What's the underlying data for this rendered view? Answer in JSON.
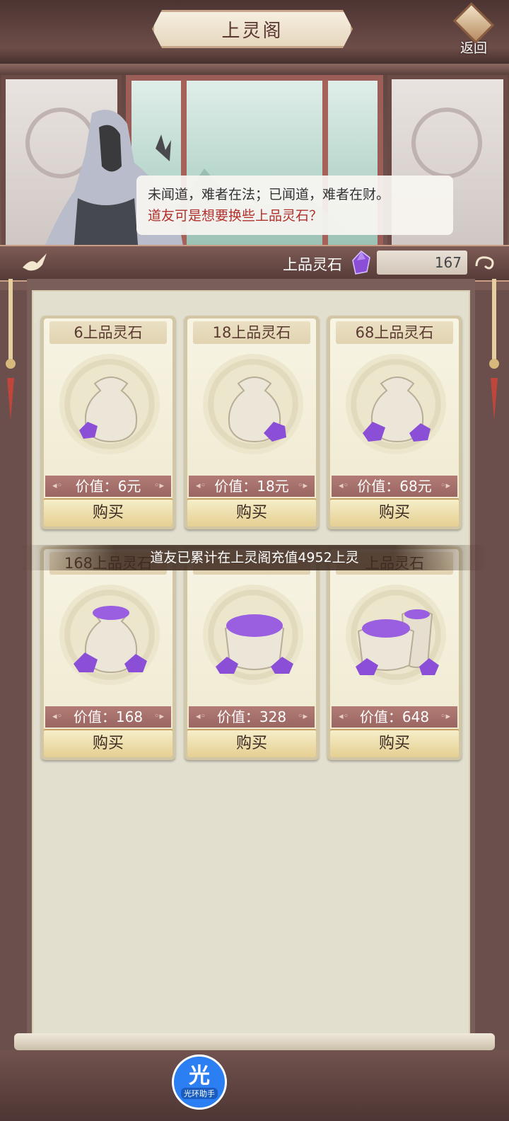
{
  "header": {
    "title": "上灵阁",
    "back_label": "返回"
  },
  "dialogue": {
    "line1": "未闻道，难者在法；已闻道，难者在财。",
    "line2": "道友可是想要换些上品灵石？"
  },
  "currency": {
    "label": "上品灵石",
    "amount": "167",
    "gem_icon": "purple-gem-icon"
  },
  "products": [
    {
      "name": "6上品灵石",
      "price": "价值：6元",
      "buy": "购买"
    },
    {
      "name": "18上品灵石",
      "price": "价值：18元",
      "buy": "购买"
    },
    {
      "name": "68上品灵石",
      "price": "价值：68元",
      "buy": "购买"
    },
    {
      "name": "168上品灵石",
      "price": "价值：168",
      "buy": "购买"
    },
    {
      "name": "",
      "price": "价值：328",
      "buy": "购买"
    },
    {
      "name": "上品灵石",
      "price": "价值：648",
      "buy": "购买"
    }
  ],
  "notice": "道友已累计在上灵阁充值4952上灵",
  "helper": {
    "glyph": "光",
    "label": "光环助手"
  },
  "colors": {
    "accent_red": "#b0302b",
    "price_strip": "#a36d68",
    "gem_purple": "#8a4fd6",
    "helper_blue": "#2c7ff3"
  }
}
